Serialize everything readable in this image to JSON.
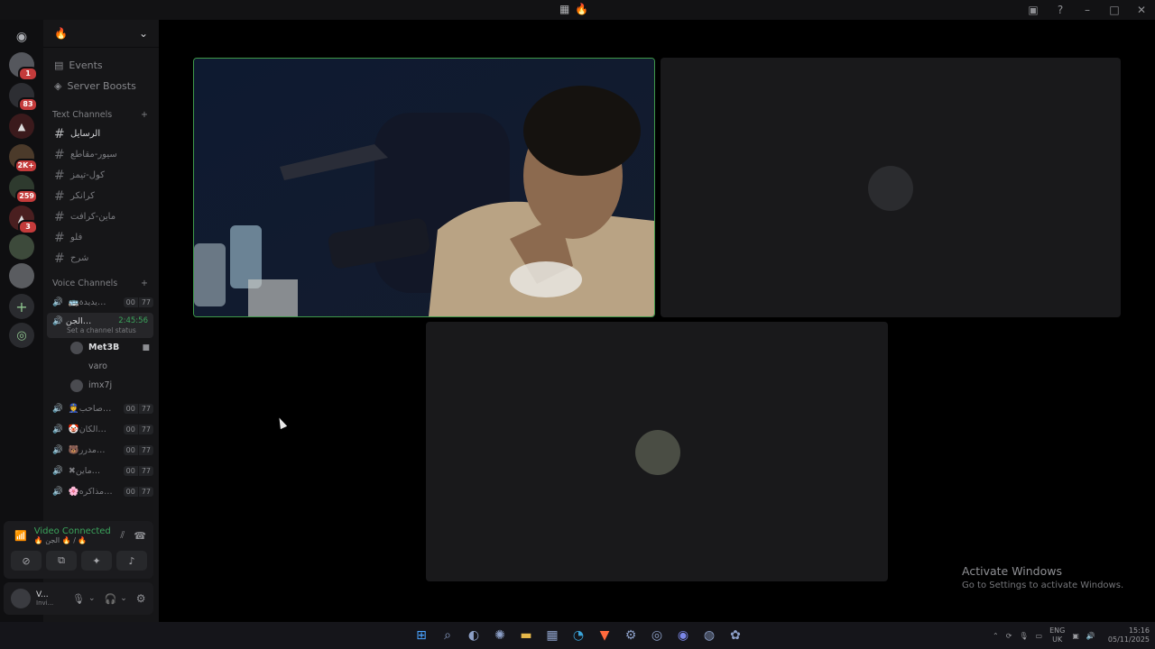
{
  "titlebar": {
    "center_icon": "community-icon",
    "center_emoji": "flame-icon",
    "right_icons": [
      "inbox-icon",
      "help-icon",
      "minimize-icon",
      "maximize-icon",
      "close-icon"
    ]
  },
  "rail": {
    "servers": [
      {
        "id": "srv1",
        "badge": "1"
      },
      {
        "id": "srv2",
        "badge": "83"
      },
      {
        "id": "srv3",
        "badge": ""
      },
      {
        "id": "srv4",
        "badge": "2K+"
      },
      {
        "id": "srv5",
        "badge": "259"
      },
      {
        "id": "srv6",
        "badge": "3"
      },
      {
        "id": "srv7",
        "badge": ""
      },
      {
        "id": "srv8",
        "badge": ""
      }
    ]
  },
  "sidebar": {
    "server_name": "🔥",
    "events_label": "Events",
    "boosts_label": "Server Boosts",
    "text_category": "Text Channels",
    "text_channels": [
      "الرسايل",
      "سيور-مقاطع",
      "كول-تيمز",
      "كرانكر",
      "ماين-كرافت",
      "فلو",
      "شرح"
    ],
    "voice_category": "Voice Channels",
    "voice_channels_top": [
      {
        "name": "🚌يديدة…",
        "c1": "00",
        "c2": "77"
      }
    ],
    "active_voice": {
      "name": "الجن…",
      "timer": "2:45:56",
      "status": "Set a channel status"
    },
    "members": [
      {
        "name": "Met3B",
        "me": true
      },
      {
        "name": "varo",
        "me": false
      },
      {
        "name": "imx7j",
        "me": false
      }
    ],
    "voice_channels_bottom": [
      {
        "name": "👮صاحب…",
        "c1": "00",
        "c2": "77"
      },
      {
        "name": "🤡الكان…",
        "c1": "00",
        "c2": "77"
      },
      {
        "name": "🐻مدرر…",
        "c1": "00",
        "c2": "77"
      },
      {
        "name": "✖ماين…",
        "c1": "00",
        "c2": "77"
      },
      {
        "name": "🌸مذاكره…",
        "c1": "00",
        "c2": "77"
      }
    ]
  },
  "voice_panel": {
    "status": "Video Connected",
    "location": "🔥 الجن 🔥 / 🔥"
  },
  "user_panel": {
    "name": "V...",
    "subtitle": "Invi..."
  },
  "stage": {
    "tile_video_name": "video-stream",
    "activate_title": "Activate Windows",
    "activate_sub": "Go to Settings to activate Windows."
  },
  "taskbar": {
    "lang1": "ENG",
    "lang2": "UK",
    "time": "15:16",
    "date": "05/11/2025"
  },
  "colors": {
    "accent_green": "#3f9a4a",
    "badge_red": "#c43b3b"
  }
}
